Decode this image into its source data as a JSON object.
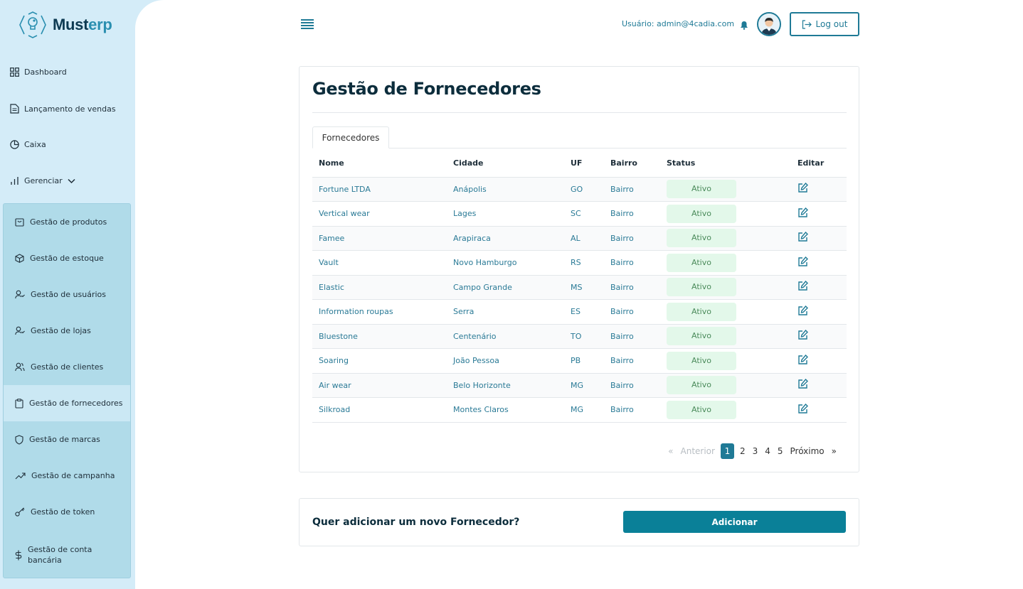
{
  "brand": {
    "name_prefix": "Must",
    "name_suffix": "erp"
  },
  "sidebar": {
    "items": [
      {
        "label": "Dashboard",
        "icon": "grid-icon"
      },
      {
        "label": "Lançamento de vendas",
        "icon": "document-icon"
      },
      {
        "label": "Caixa",
        "icon": "pie-chart-icon"
      },
      {
        "label": "Gerenciar",
        "icon": "bar-chart-icon"
      }
    ],
    "submenu": [
      {
        "label": "Gestão de produtos",
        "icon": "bag-icon"
      },
      {
        "label": "Gestão de estoque",
        "icon": "box-icon"
      },
      {
        "label": "Gestão de usuários",
        "icon": "user-check-icon"
      },
      {
        "label": "Gestão de lojas",
        "icon": "user-check-icon"
      },
      {
        "label": "Gestão de clientes",
        "icon": "users-icon"
      },
      {
        "label": "Gestão de fornecedores",
        "icon": "clipboard-icon",
        "active": true
      },
      {
        "label": "Gestão de marcas",
        "icon": "shield-icon"
      },
      {
        "label": "Gestão de campanha",
        "icon": "trending-up-icon"
      },
      {
        "label": "Gestão de token",
        "icon": "key-icon"
      },
      {
        "label": "Gestão de conta bancária",
        "icon": "dollar-icon"
      }
    ]
  },
  "header": {
    "user_label": "Usuário: admin@4cadia.com",
    "logout_label": "Log out"
  },
  "main": {
    "title": "Gestão de Fornecedores",
    "tab_label": "Fornecedores",
    "columns": [
      "Nome",
      "Cidade",
      "UF",
      "Bairro",
      "Status",
      "Editar"
    ],
    "rows": [
      {
        "nome": "Fortune LTDA",
        "cidade": "Anápolis",
        "uf": "GO",
        "bairro": "Bairro",
        "status": "Ativo"
      },
      {
        "nome": "Vertical wear",
        "cidade": "Lages",
        "uf": "SC",
        "bairro": "Bairro",
        "status": "Ativo"
      },
      {
        "nome": "Famee",
        "cidade": "Arapiraca",
        "uf": "AL",
        "bairro": "Bairro",
        "status": "Ativo"
      },
      {
        "nome": "Vault",
        "cidade": "Novo Hamburgo",
        "uf": "RS",
        "bairro": "Bairro",
        "status": "Ativo"
      },
      {
        "nome": "Elastic",
        "cidade": "Campo Grande",
        "uf": "MS",
        "bairro": "Bairro",
        "status": "Ativo"
      },
      {
        "nome": "Information roupas",
        "cidade": "Serra",
        "uf": "ES",
        "bairro": "Bairro",
        "status": "Ativo"
      },
      {
        "nome": "Bluestone",
        "cidade": "Centenário",
        "uf": "TO",
        "bairro": "Bairro",
        "status": "Ativo"
      },
      {
        "nome": "Soaring",
        "cidade": "João Pessoa",
        "uf": "PB",
        "bairro": "Bairro",
        "status": "Ativo"
      },
      {
        "nome": "Air wear",
        "cidade": "Belo Horizonte",
        "uf": "MG",
        "bairro": "Bairro",
        "status": "Ativo"
      },
      {
        "nome": "Silkroad",
        "cidade": "Montes Claros",
        "uf": "MG",
        "bairro": "Bairro",
        "status": "Ativo"
      }
    ],
    "pagination": {
      "prev_symbol": "«",
      "prev_label": "Anterior",
      "pages": [
        "1",
        "2",
        "3",
        "4",
        "5"
      ],
      "current": "1",
      "next_label": "Próximo",
      "next_symbol": "»"
    }
  },
  "add_section": {
    "question": "Quer adicionar um novo Fornecedor?",
    "button_label": "Adicionar"
  },
  "colors": {
    "accent": "#0a8098",
    "sidebar_bg": "#d4ecf8",
    "submenu_bg": "#b0dbe9",
    "status_bg": "#e3f8ea"
  }
}
